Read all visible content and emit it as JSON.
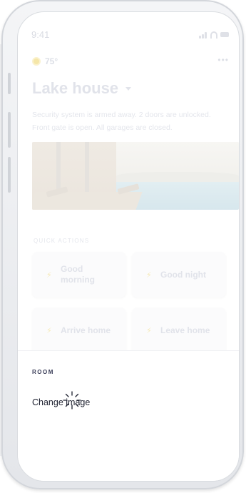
{
  "status_bar": {
    "time": "9:41"
  },
  "weather": {
    "temperature": "75°",
    "icon": "sun-icon"
  },
  "header": {
    "more_label": "•••",
    "location_title": "Lake house"
  },
  "summary": "Security system is armed away. 2 doors are unlocked. Front gate is open. All garages are closed.",
  "hero_image": {
    "icon": "photo-lake-house"
  },
  "quick_actions": {
    "label": "QUICK ACTIONS",
    "items": [
      {
        "label": "Good morning",
        "icon": "bolt-icon"
      },
      {
        "label": "Good night",
        "icon": "bolt-icon"
      },
      {
        "label": "Arrive home",
        "icon": "bolt-icon"
      },
      {
        "label": "Leave home",
        "icon": "bolt-icon"
      }
    ]
  },
  "sheet": {
    "section_label": "ROOM",
    "action_label": "Change image",
    "loading_icon": "spinner-icon"
  },
  "colors": {
    "accent": "#f5e6a8",
    "text_dark": "#1c1f2e",
    "section_label": "#3a3d58"
  }
}
